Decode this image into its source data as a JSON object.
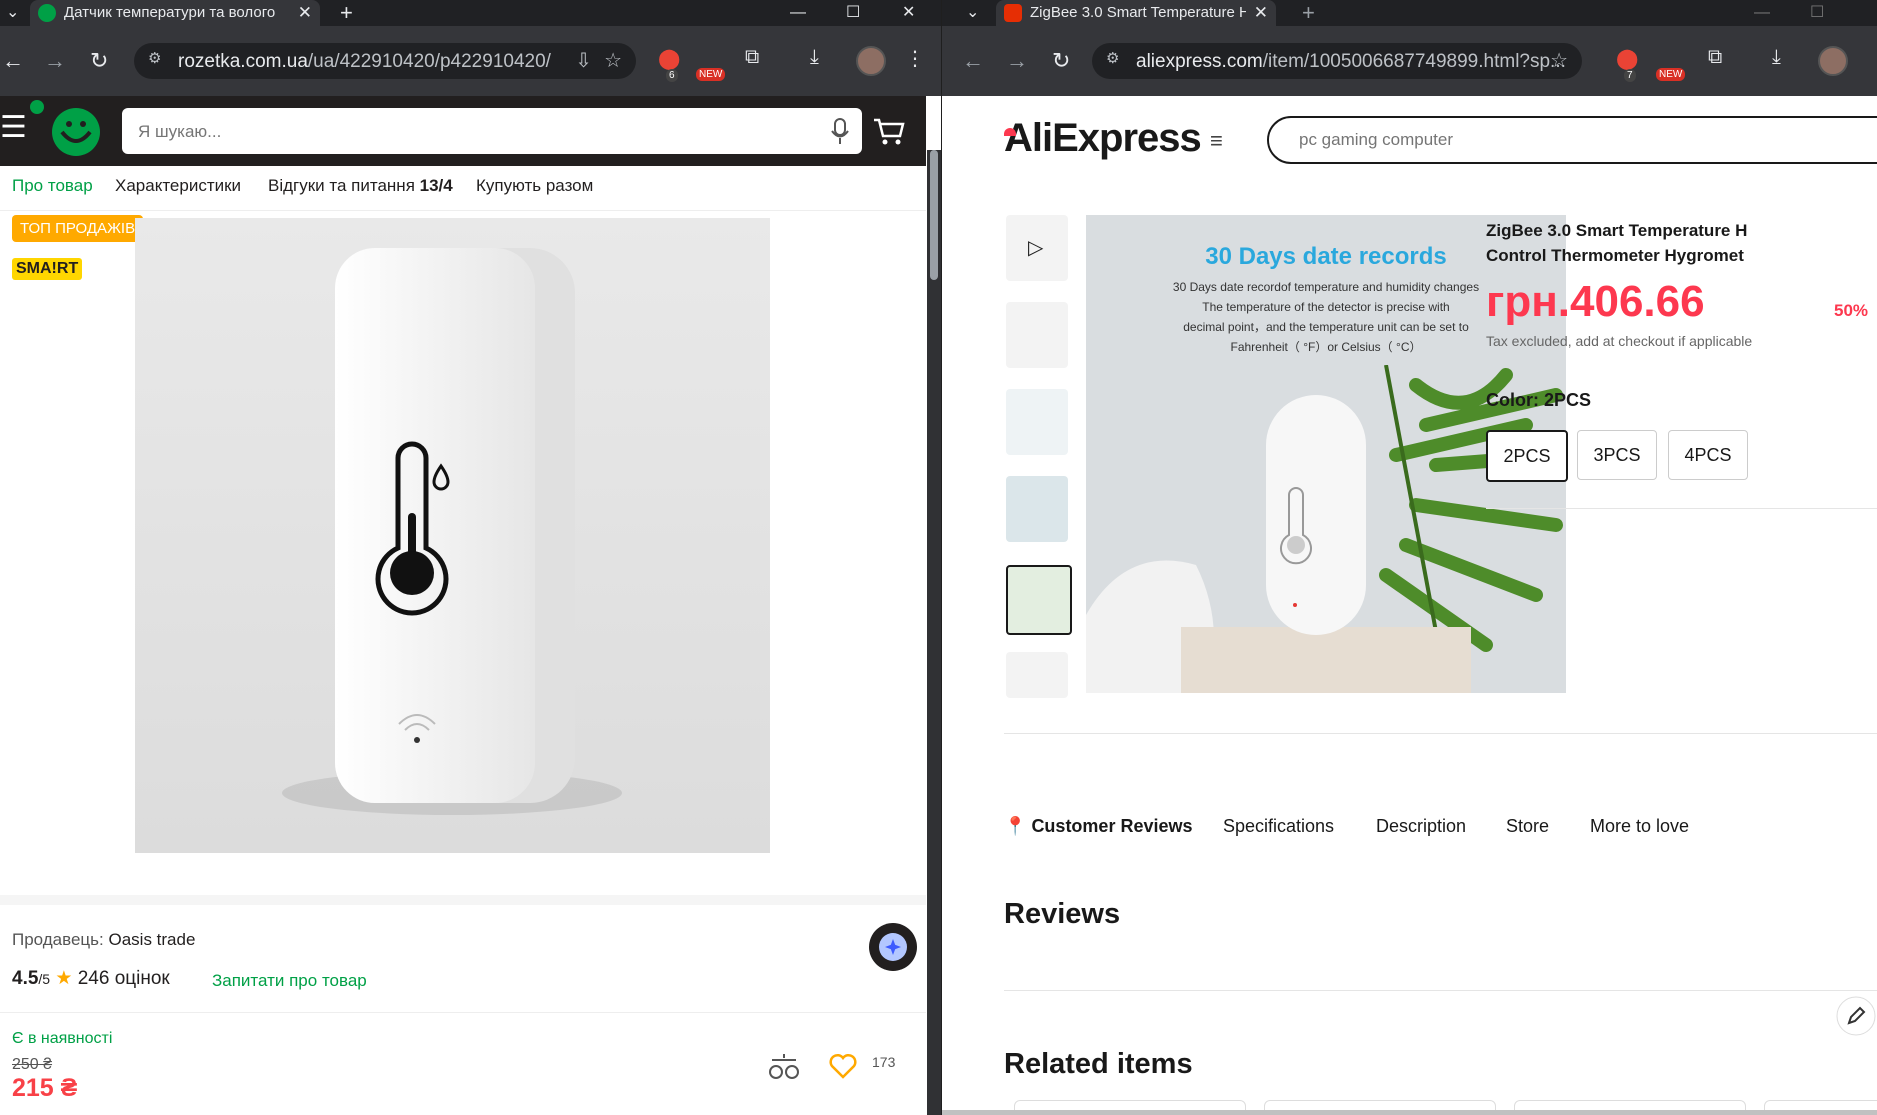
{
  "left_window": {
    "tab": {
      "title": "Датчик температури та волого"
    },
    "toolbar": {
      "url_domain": "rozetka.com.ua",
      "url_path": "/ua/422910420/p422910420/",
      "ext_badge": "6",
      "new_badge": "NEW"
    },
    "header": {
      "search_placeholder": "Я шукаю..."
    },
    "tabs": [
      {
        "label": "Про товар"
      },
      {
        "label": "Характеристики"
      },
      {
        "label": "Відгуки та питання",
        "count": "13/4"
      },
      {
        "label": "Купують разом"
      }
    ],
    "badges": {
      "top": "ТОП ПРОДАЖІВ",
      "smart": "SMA!RT"
    },
    "seller": {
      "label": "Продавець:",
      "name": "Oasis trade"
    },
    "rating": {
      "value": "4.5",
      "max": "/5",
      "count_text": "246 оцінок",
      "ask": "Запитати про товар"
    },
    "availability": "Є в наявності",
    "price": {
      "old": "250 ₴",
      "current": "215 ₴"
    },
    "favorites_count": "173"
  },
  "right_window": {
    "tab": {
      "title": "ZigBee 3.0 Smart Temperature H"
    },
    "toolbar": {
      "url_domain": "aliexpress.com",
      "url_path": "/item/1005006687749899.html?sp...",
      "ext_badge": "7",
      "new_badge": "NEW"
    },
    "logo": "AliExpress",
    "search_placeholder": "pc gaming computer",
    "main_image": {
      "title": "30 Days date records",
      "lines": [
        "30 Days date recordof temperature and humidity changes",
        "The temperature of the detector is precise with",
        "decimal point，and the temperature unit can be set to",
        "Fahrenheit（ °F）or Celsius（ °C）"
      ]
    },
    "product": {
      "title_line1": "ZigBee 3.0 Smart Temperature H",
      "title_line2": "Control Thermometer Hygromet",
      "price": "грн.406.66",
      "discount": "50%",
      "tax_note": "Tax excluded, add at checkout if applicable",
      "color_label": "Color: 2PCS",
      "options": [
        "2PCS",
        "3PCS",
        "4PCS"
      ]
    },
    "nav": [
      "Customer Reviews",
      "Specifications",
      "Description",
      "Store",
      "More to love"
    ],
    "reviews_heading": "Reviews",
    "related_heading": "Related items"
  }
}
